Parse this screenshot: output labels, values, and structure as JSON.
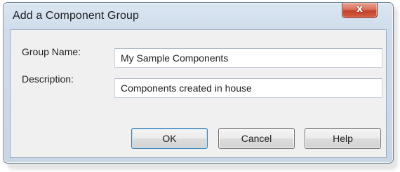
{
  "window": {
    "title": "Add a Component Group",
    "close_glyph": "x"
  },
  "form": {
    "group_name_label": "Group Name:",
    "group_name_value": "My Sample Components",
    "description_label": "Description:",
    "description_value": "Components created in house"
  },
  "buttons": {
    "ok": "OK",
    "cancel": "Cancel",
    "help": "Help"
  },
  "colors": {
    "title_bar": "#cfdceb",
    "close_button": "#c0432b",
    "client_area": "#f0f0f0"
  }
}
